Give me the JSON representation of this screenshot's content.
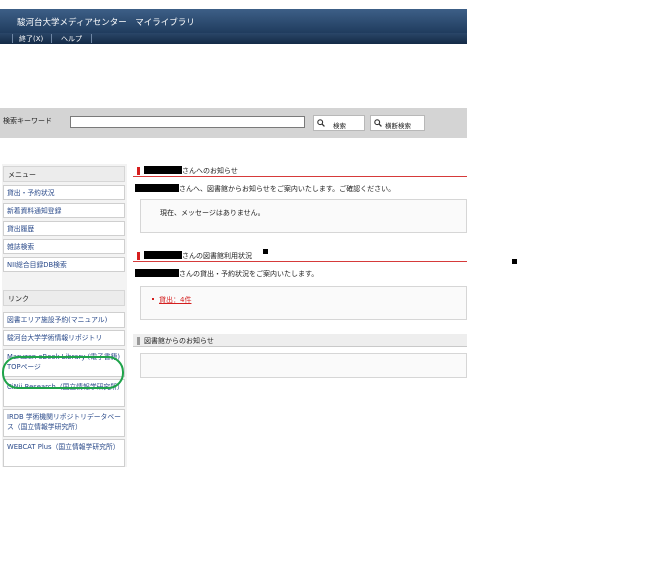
{
  "window": {
    "title": "駿河台大学メディアセンター　マイライブラリ"
  },
  "menubar": {
    "exit": "終了(X)",
    "help": "ヘルプ"
  },
  "search": {
    "label": "検索キーワード",
    "value": "",
    "search_btn": "検索",
    "cross_btn": "横断検索"
  },
  "sidebar": {
    "menu_head": "メニュー",
    "menu_items": [
      "貸出・予約状況",
      "新着資料通知登録",
      "貸出履歴",
      "雑誌検索",
      "NII総合目録DB検索"
    ],
    "link_head": "リンク",
    "links": [
      "図書エリア施設予約(マニュアル)",
      "駿河台大学学術情報リポジトリ",
      "Maruzen eBook Library (電子書籍) TOPページ",
      "CiNii Research（国立情報学研究所）",
      "IRDB 学術機関リポジトリデータベース（国立情報学研究所）",
      "WEBCAT Plus（国立情報学研究所）"
    ]
  },
  "notice": {
    "title_suffix": "さんへのお知らせ",
    "intro_suffix": "さんへ、図書館からお知らせをご案内いたします。ご確認ください。",
    "message": "現在、メッセージはありません。"
  },
  "usage": {
    "title_suffix": "さんの図書館利用状況",
    "intro_suffix": "さんの貸出・予約状況をご案内いたします。",
    "loan_link": "貸出：4件"
  },
  "library_notice": {
    "title": "図書館からのお知らせ"
  },
  "colors": {
    "header": "#203c5e",
    "accent_red": "#d61e1e",
    "highlight_green": "#1ea34a"
  }
}
